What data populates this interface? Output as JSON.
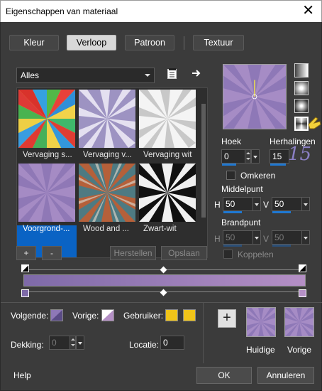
{
  "window": {
    "title": "Eigenschappen van materiaal",
    "close_glyph": "✕"
  },
  "tabs": [
    {
      "label": "Kleur",
      "active": false
    },
    {
      "label": "Verloop",
      "active": true
    },
    {
      "label": "Patroon",
      "active": false
    },
    {
      "label": "Textuur",
      "active": false
    }
  ],
  "category": {
    "selected": "Alles"
  },
  "gallery": {
    "items": [
      {
        "label": "Vervaging s...",
        "selected": false
      },
      {
        "label": "Vervaging v...",
        "selected": false
      },
      {
        "label": "Vervaging wit",
        "selected": false
      },
      {
        "label": "Voorgrond-...",
        "selected": true
      },
      {
        "label": "Wood and ...",
        "selected": false
      },
      {
        "label": "Zwart-wit",
        "selected": false
      }
    ]
  },
  "gallery_buttons": {
    "add": "+",
    "remove": "-",
    "restore": "Herstellen",
    "save": "Opslaan"
  },
  "angle": {
    "label": "Hoek",
    "value": "0"
  },
  "repeats": {
    "label": "Herhalingen",
    "value": "15",
    "overlay_number": "15"
  },
  "invert": {
    "label": "Omkeren",
    "checked": false
  },
  "center": {
    "label": "Middelpunt",
    "h_label": "H",
    "h_value": "50",
    "v_label": "V",
    "v_value": "50"
  },
  "focus": {
    "label": "Brandpunt",
    "h_label": "H",
    "h_value": "50",
    "v_label": "V",
    "v_value": "50"
  },
  "link": {
    "label": "Koppelen",
    "checked": false
  },
  "stops": {
    "next_label": "Volgende:",
    "prev_label": "Vorige:",
    "user_label": "Gebruiker:",
    "user_color": "#f0c419",
    "opacity_label": "Dekking:",
    "opacity_value": "0",
    "location_label": "Locatie:",
    "location_value": "0"
  },
  "gradient": {
    "start_color": "#7e6aa8",
    "end_color": "#b48fc5"
  },
  "current": {
    "label": "Huidige"
  },
  "previous": {
    "label": "Vorige"
  },
  "footer": {
    "help": "Help",
    "ok": "OK",
    "cancel": "Annuleren"
  },
  "colors": {
    "dialog_bg": "#3b3b3b",
    "accent": "#0a63c4",
    "purple": "#b48fc5"
  }
}
